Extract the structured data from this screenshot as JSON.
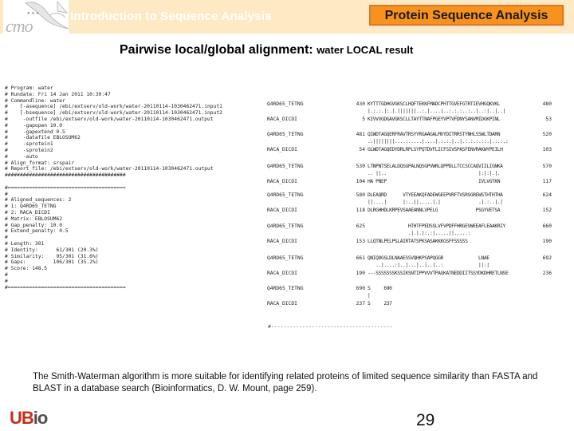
{
  "header": {
    "logo_text": "cmo",
    "course_title": "Introduction to Sequence Analysis",
    "section_badge": "Protein Sequence Analysis",
    "colors": {
      "band": "#fde9c4",
      "badge": "#f7921e",
      "badge_border": "#e3751a"
    }
  },
  "slide": {
    "title": "Pairwise local/global alignment:",
    "subtitle": "water LOCAL result"
  },
  "report_header": {
    "lines": [
      "# Program: water",
      "# Rundate: Fri 14 Jan 2011 10:30:47",
      "# Commandline: water",
      "#    [-asequence] /ebi/extserv/old-work/water-20110114-1030462471.input1",
      "#    [-bsequence] /ebi/extserv/old-work/water-20110114-1030462471.input2",
      "#     -outfile /ebi/extserv/old-work/water-20110114-1030462471.output",
      "#     -gapopen 10.0",
      "#     -gapextend 0.5",
      "#     -datafile EBLOSUM62",
      "#     -sprotein1",
      "#     -sprotein2",
      "#     -auto",
      "# Align_format: srspair",
      "# Report_file: /ebi/extserv/old-work/water-20110114-1030462471.output",
      "########################################",
      "",
      "#=======================================",
      "#",
      "# Aligned_sequences: 2",
      "# 1: Q4RD65_TETNG",
      "# 2: RACA_DICDI",
      "# Matrix: EBLOSUM62",
      "# Gap_penalty: 10.0",
      "# Extend_penalty: 0.5",
      "#",
      "# Length: 301",
      "# Identity:      61/301 (20.3%)",
      "# Similarity:    95/301 (31.6%)",
      "# Gaps:         106/301 (35.2%)",
      "# Score: 148.5",
      "#",
      "#",
      "#======================================="
    ]
  },
  "alignment": {
    "blocks": [
      {
        "top": {
          "name": "Q4RD65_TETNG",
          "start": "430",
          "seq": "KYTTTGDHGVGKSCLHQFTEKKFMADCPHTTGVEFGTRTIEVHGQKVKL",
          "end": "480"
        },
        "match": "|.:.:.|:.|.|||||||..:.|....|..:.:.:..:..|..:|..|..|",
        "bottom": {
          "name": "RACA_DICDI",
          "start": "5",
          "seq": "KIVVVGDGAVGKSCLLTAYTTNAFPGEYVPTVFDNYSANVMIDGKPINL",
          "end": "53"
        }
      },
      {
        "top": {
          "name": "Q4RD65_TETNG",
          "start": "481",
          "seq": "QIWDTAGQERFRAVTRSYYRGAAGALMVYDITRRSTYNHLSSWLTDARN",
          "end": "520"
        },
        "match": ".:||||||||....:.....|....|.:.:.|..|.:.:.:.::.|.:.:.:",
        "bottom": {
          "name": "RACA_DICDI",
          "start": "54",
          "seq": "GLWDTAGQEDYDRLRPLSYPQTDVFLICFSIVSPASFENVRAKWYPEILH",
          "end": "103"
        }
      },
      {
        "top": {
          "name": "Q4RD65_TETNG",
          "start": "530",
          "seq": "LTNPNTSELALDQSGPALNQSGPVWRLQPPDLLTCCSCCAQVIILIGNKA",
          "end": "570"
        },
        "match": ".. ||..                                  |:|:|.|.",
        "bottom": {
          "name": "RACA_DICDI",
          "start": "104",
          "seq": "HA PNEP                                  IVLVGTKN",
          "end": "117"
        }
      },
      {
        "top": {
          "name": "Q4RD65_TETNG",
          "start": "580",
          "seq": "DLEAQRD      VTYEEAKQFADEWGEEPVRFTVSRSGREWSTHTHTHA",
          "end": "624"
        },
        "match": "||....|      |:..||.....|.|              .|.:..|.|",
        "bottom": {
          "name": "RACA_DICDI",
          "start": "118",
          "seq": "DLRGHHDLKRPEVSAAEANNLVPELG              PSGYVETSA",
          "end": "152"
        }
      },
      {
        "top": {
          "name": "Q4RD65_TETNG",
          "start": "625",
          "seq": "               HTHTFPEDSSLVFVPDFFHRGEVWEEAFLEAAKRIY",
          "end": "660"
        },
        "match": "               .|.|.|:.:|.....||.....:",
        "bottom": {
          "name": "RACA_DICDI",
          "start": "153",
          "seq": "LLQTNLPELPSLAIRTATSPKSASAKKKGSFFSSSSS",
          "end": "190"
        }
      },
      {
        "top": {
          "name": "Q4RD65_TETNG",
          "start": "661",
          "seq": "QNIQDGSLDLNAAESSVQHKPSAPQGGR             LNAE",
          "end": "692"
        },
        "match": "   ..|....:|..|...|..|..|..:             ||:|",
        "bottom": {
          "name": "RACA_DICDI",
          "start": "190",
          "seq": "---SSSSSSSKSSIKSNTIPPVVVTPAGKATNEDDIITSSYDKDHRETLNSE",
          "end": "236"
        }
      },
      {
        "top": {
          "name": "Q4RD65_TETNG",
          "start": "690",
          "seq": "S     690",
          "end": ""
        },
        "match": "|",
        "bottom": {
          "name": "RACA_DICDI",
          "start": "237",
          "seq": "S     237",
          "end": ""
        }
      }
    ],
    "footer_line": "#---------------------------------------"
  },
  "caption": "The Smith-Waterman algorithm is more suitable for identifying related proteins of limited sequence similarity than FASTA and BLAST in a database search (Bioinformatics, D. W. Mount, page 259).",
  "footer": {
    "logo_ub": "UB",
    "logo_io": "io",
    "page_number": "29"
  }
}
